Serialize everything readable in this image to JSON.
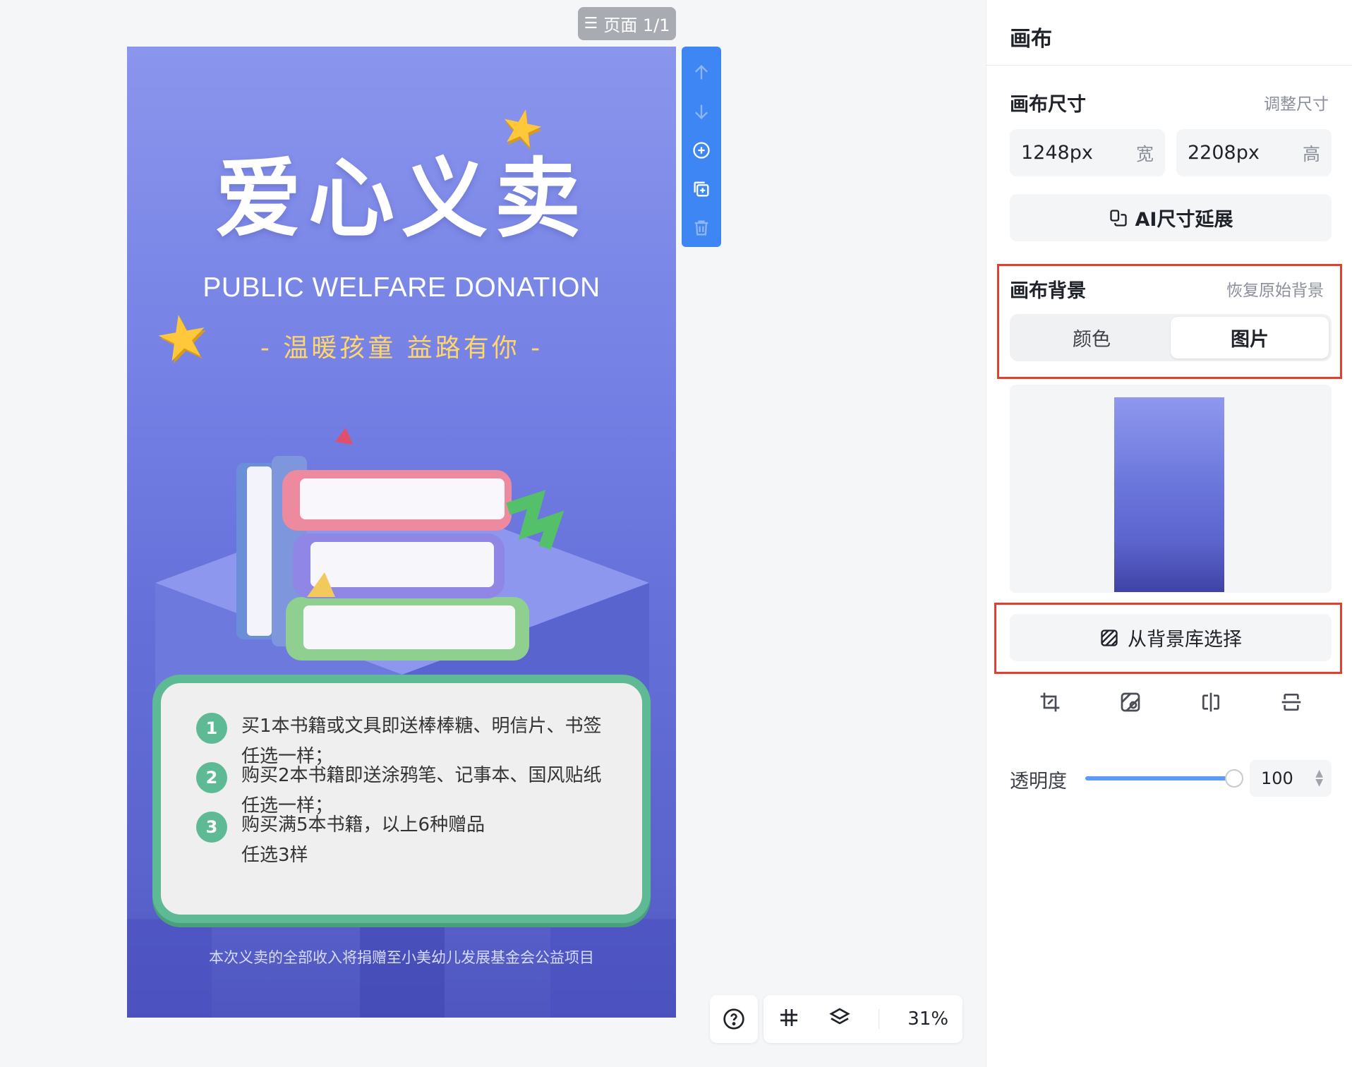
{
  "workspace": {
    "page_indicator": "页面 1/1",
    "zoom_level": "31%"
  },
  "poster": {
    "title": "爱心义卖",
    "subtitle": "PUBLIC WELFARE DONATION",
    "tagline": "- 温暖孩童 益路有你 -",
    "offers": [
      {
        "num": "1",
        "line1": "买1本书籍或文具即送棒棒糖、明信片、书签",
        "line2": "任选一样；"
      },
      {
        "num": "2",
        "line1": "购买2本书籍即送涂鸦笔、记事本、国风贴纸",
        "line2": "任选一样；"
      },
      {
        "num": "3",
        "line1": "购买满5本书籍，以上6种赠品",
        "line2": "任选3样"
      }
    ],
    "footer": "本次义卖的全部收入将捐赠至小美幼儿发展基金会公益项目"
  },
  "float_toolbar": {
    "icons": [
      "arrow-up-icon",
      "arrow-down-icon",
      "add-page-icon",
      "duplicate-page-icon",
      "delete-icon"
    ]
  },
  "panel": {
    "title": "画布",
    "canvas_size": {
      "label": "画布尺寸",
      "adjust_link": "调整尺寸",
      "width_value": "1248px",
      "width_unit": "宽",
      "height_value": "2208px",
      "height_unit": "高",
      "ai_extend_label": "AI尺寸延展"
    },
    "canvas_background": {
      "label": "画布背景",
      "restore_link": "恢复原始背景",
      "tabs": [
        "颜色",
        "图片"
      ],
      "active_tab": "图片",
      "library_button": "从背景库选择"
    },
    "opacity": {
      "label": "透明度",
      "value": "100",
      "level": 1.0
    }
  },
  "colors": {
    "accent": "#3f86f5",
    "highlight_border": "#e0402f",
    "offer_green": "#5dba95"
  }
}
